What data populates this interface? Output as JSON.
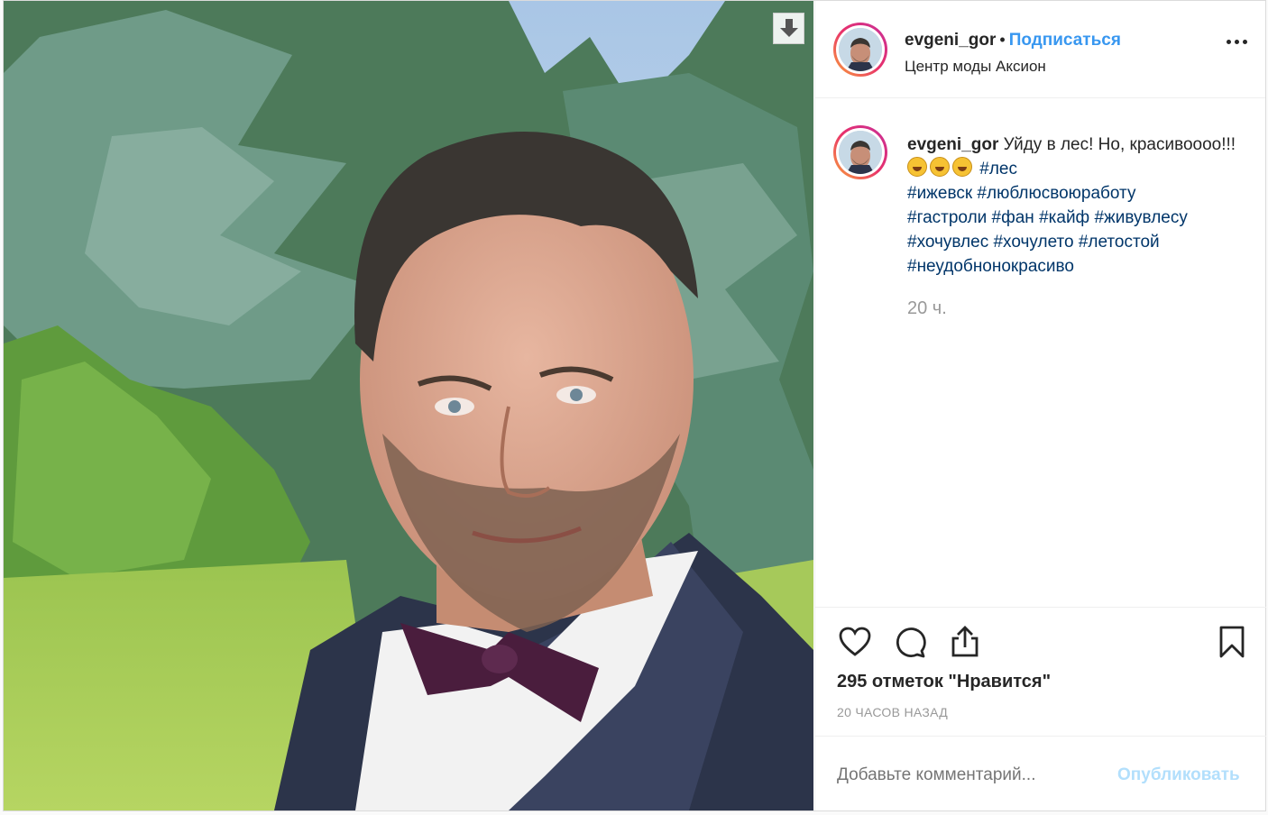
{
  "post": {
    "username": "evgeni_gor",
    "separator": "•",
    "follow_label": "Подписаться",
    "location": "Центр моды Аксион",
    "caption_text": "Уйду в лес! Но, красивоооо!!!",
    "hashtags_line1": "#лес",
    "hashtags_line2": "#ижевск #люблюсвоюработу",
    "hashtags_line3": "#гастроли #фан #кайф #живувлесу",
    "hashtags_line4": "#хочувлес #хочулето #летостой",
    "hashtags_line5": "#неудобнонокрасиво",
    "caption_time": "20 ч.",
    "likes": "295 отметок \"Нравится\"",
    "posted_ago": "20 ЧАСОВ НАЗАД",
    "comment_placeholder": "Добавьте комментарий...",
    "publish_label": "Опубликовать"
  },
  "icons": {
    "download": "download-icon",
    "more": "more-options-icon",
    "like": "heart-icon",
    "comment": "comment-icon",
    "share": "share-icon",
    "save": "bookmark-icon",
    "emoji": "rolling-laughing-emoji"
  },
  "colors": {
    "link_blue": "#3897f0",
    "hashtag": "#003569",
    "muted": "#999999",
    "publish_disabled": "#b2dffc"
  }
}
